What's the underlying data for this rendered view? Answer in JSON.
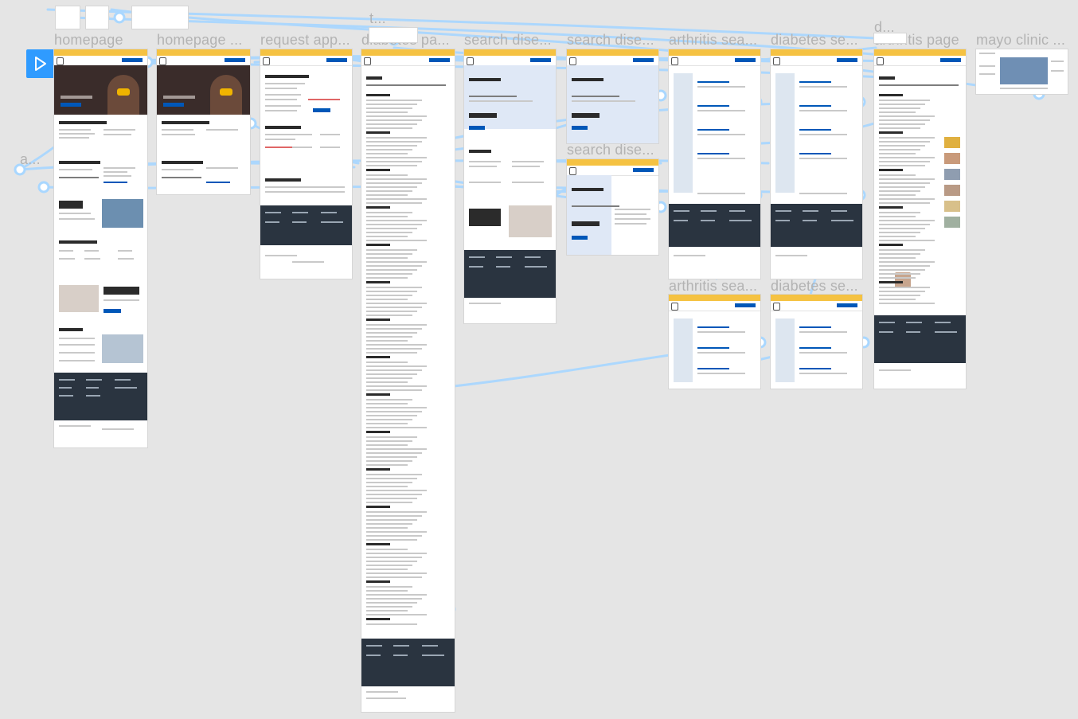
{
  "canvas": {
    "background": "#e5e5e5",
    "connector_color": "#a9d7ff",
    "accent_color": "#f5c242",
    "brand_blue": "#0057b8",
    "footer_color": "#2a3440"
  },
  "toolbar": {
    "play_icon": "play-icon"
  },
  "labels": {
    "homepage": "homepage",
    "homepage_copy": "homepage ...",
    "request": "request app...",
    "t": "t...",
    "diabetes_page": "diabetes pa...",
    "search1": "search dise...",
    "search2": "search dise...",
    "search3": "search dise...",
    "arthritis_search1": "arthritis sea...",
    "arthritis_search2": "arthritis sea...",
    "diabetes_search1": "diabetes se...",
    "diabetes_search2": "diabetes se...",
    "d": "d...",
    "arthritis_page": "arthritis page",
    "mayo": "mayo clinic ...",
    "a": "a..."
  },
  "frames": {
    "homepage": {
      "hero_text": "We're all in this together.",
      "covid_heading": "COVID-19 Vaccine Information",
      "find_heading": "Find a Disease or Condition",
      "hospital_heading": "The #1 hospital in the nation.",
      "why_heading": "Why choose Mayo Clinic?",
      "generous_heading": "Generous support leads to breakthrough results.",
      "locations_heading": "Our Locations"
    },
    "homepage_copy": {
      "hero_text": "We're all in this together.",
      "covid_heading": "COVID-19 Vaccine Information",
      "find_heading": "Find a Disease or Condition"
    },
    "request": {
      "heading": "Request an Appointment",
      "contact_heading": "Contact us by phone",
      "intl_heading": "International Patients"
    },
    "diabetes_page": {
      "heading": "Diabetes"
    },
    "search1": {
      "heading": "Diseases & Conditions",
      "symptoms_heading": "Having symptoms?",
      "experts_heading": "Mayo Clinic experts solve the world's toughest medical problems — one patient at a time."
    },
    "search2": {
      "heading": "Diseases & Conditions",
      "symptoms_heading": "Having symptoms?"
    },
    "search3": {
      "heading": "Diseases & Conditions",
      "symptoms_heading": "Having symptoms?"
    },
    "arthritis_page": {
      "heading": "Arthritis"
    }
  }
}
